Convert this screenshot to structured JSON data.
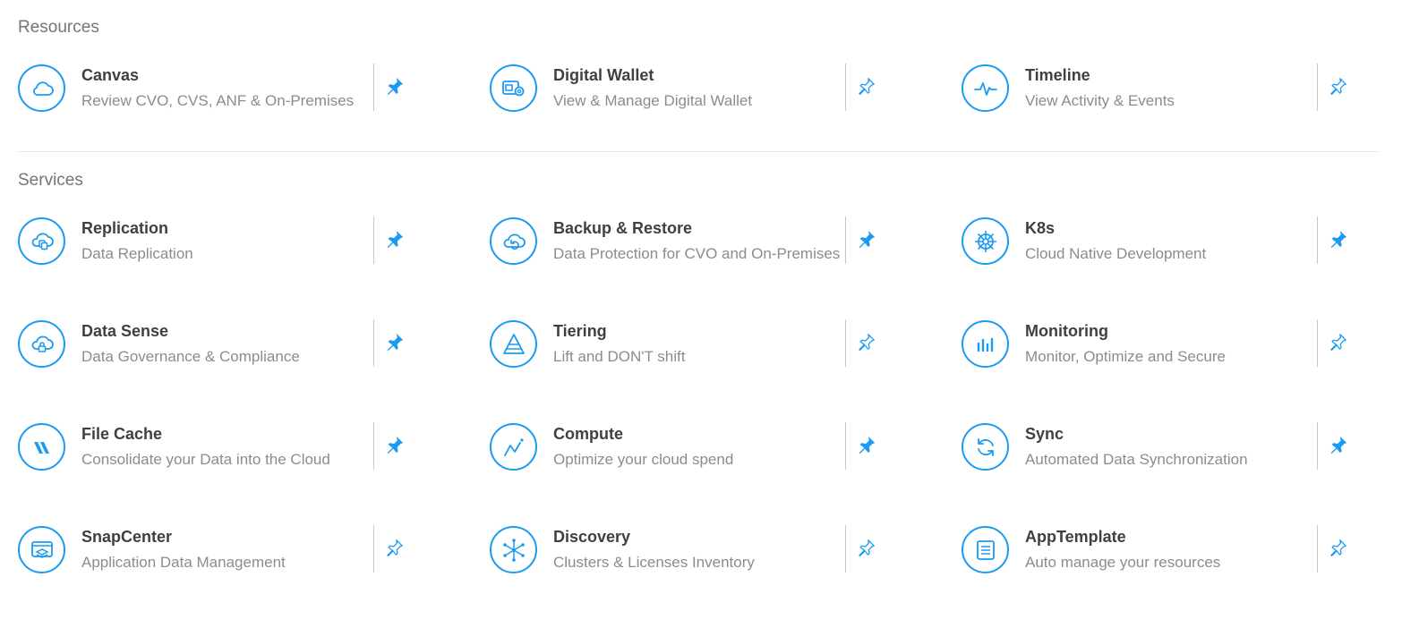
{
  "sections": {
    "resources": "Resources",
    "services": "Services"
  },
  "colors": {
    "accent": "#1a9bf2",
    "title": "#404040",
    "subtitle": "#8c8c8c",
    "heading": "#757575"
  },
  "cards": [
    {
      "title": "Canvas",
      "subtitle": "Review CVO, CVS, ANF & On-Premises",
      "icon": "cloud-icon",
      "pinned": true
    },
    {
      "title": "Digital Wallet",
      "subtitle": "View & Manage Digital Wallet",
      "icon": "wallet-icon",
      "pinned": false
    },
    {
      "title": "Timeline",
      "subtitle": "View Activity & Events",
      "icon": "pulse-icon",
      "pinned": false
    },
    {
      "title": "Replication",
      "subtitle": "Data Replication",
      "icon": "cloud-copy-icon",
      "pinned": true
    },
    {
      "title": "Backup & Restore",
      "subtitle": "Data Protection for CVO and On-Premises",
      "icon": "cloud-restore-icon",
      "pinned": true
    },
    {
      "title": "K8s",
      "subtitle": "Cloud Native Development",
      "icon": "helm-wheel-icon",
      "pinned": true
    },
    {
      "title": "Data Sense",
      "subtitle": "Data Governance & Compliance",
      "icon": "cloud-lock-icon",
      "pinned": true
    },
    {
      "title": "Tiering",
      "subtitle": "Lift and DON'T shift",
      "icon": "pyramid-icon",
      "pinned": false
    },
    {
      "title": "Monitoring",
      "subtitle": "Monitor, Optimize and Secure",
      "icon": "bar-chart-icon",
      "pinned": false
    },
    {
      "title": "File Cache",
      "subtitle": "Consolidate your Data into the Cloud",
      "icon": "file-cache-logo-icon",
      "pinned": true
    },
    {
      "title": "Compute",
      "subtitle": "Optimize your cloud spend",
      "icon": "trend-line-icon",
      "pinned": true
    },
    {
      "title": "Sync",
      "subtitle": "Automated Data Synchronization",
      "icon": "sync-icon",
      "pinned": true
    },
    {
      "title": "SnapCenter",
      "subtitle": "Application Data Management",
      "icon": "snapcenter-icon",
      "pinned": false
    },
    {
      "title": "Discovery",
      "subtitle": "Clusters & Licenses Inventory",
      "icon": "network-nodes-icon",
      "pinned": false
    },
    {
      "title": "AppTemplate",
      "subtitle": "Auto manage your resources",
      "icon": "template-document-icon",
      "pinned": false
    }
  ]
}
